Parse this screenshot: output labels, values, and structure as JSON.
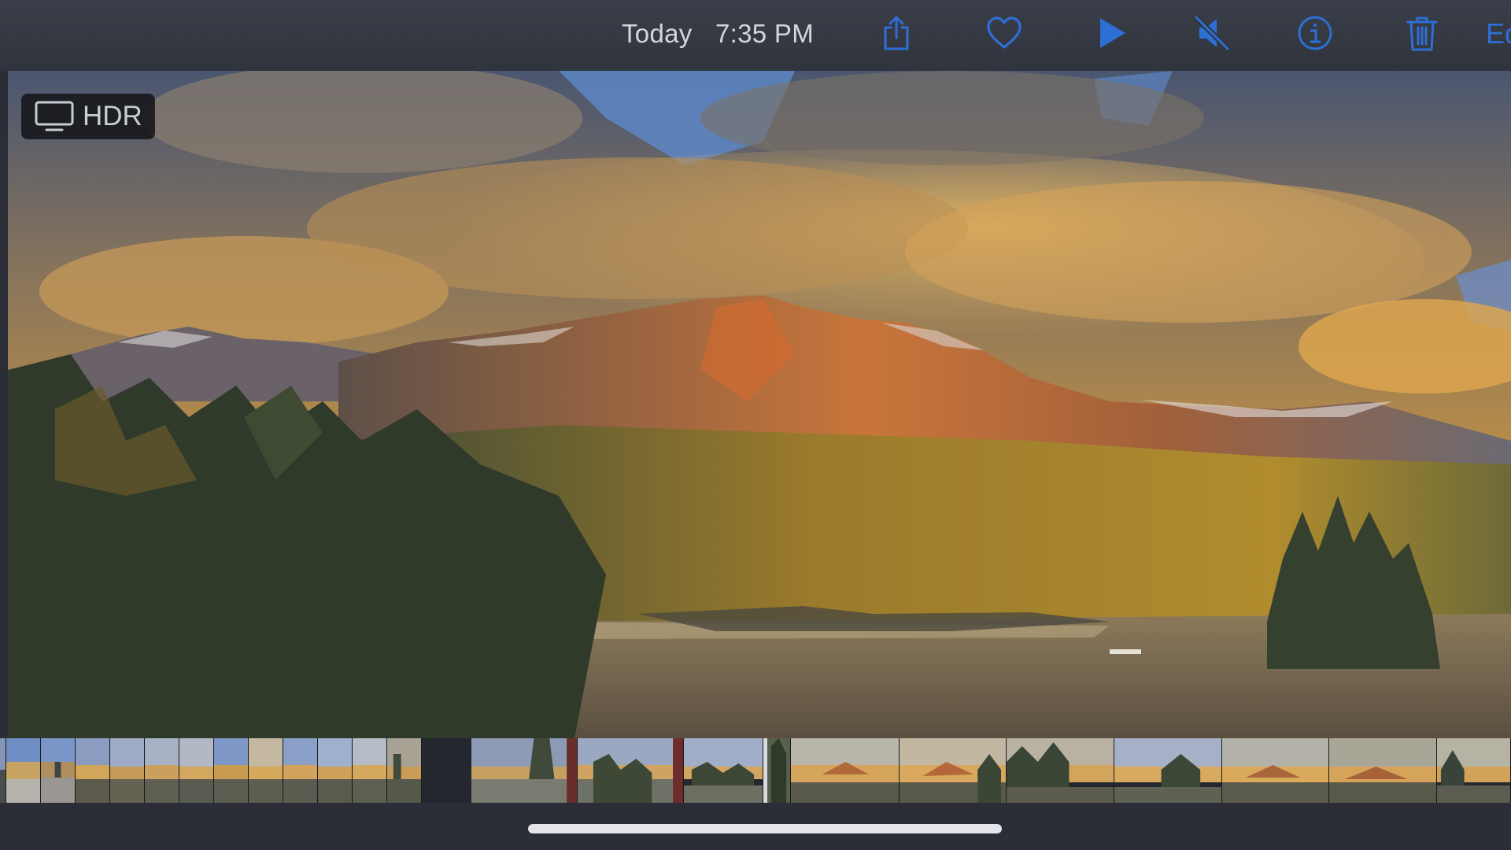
{
  "header": {
    "date_label": "Today",
    "time_label": "7:35 PM",
    "edit_label": "Ed",
    "accent_color": "#2e6fd6"
  },
  "toolbar_icons": [
    "share-icon",
    "heart-icon",
    "play-icon",
    "speaker-muted-icon",
    "info-icon",
    "trash-icon"
  ],
  "badge": {
    "label": "HDR",
    "icon": "display-icon"
  },
  "photo": {
    "subject": "mountain-lake-sunset"
  },
  "filmstrip": {
    "left_group_count": 12,
    "right_group_count": 10
  }
}
